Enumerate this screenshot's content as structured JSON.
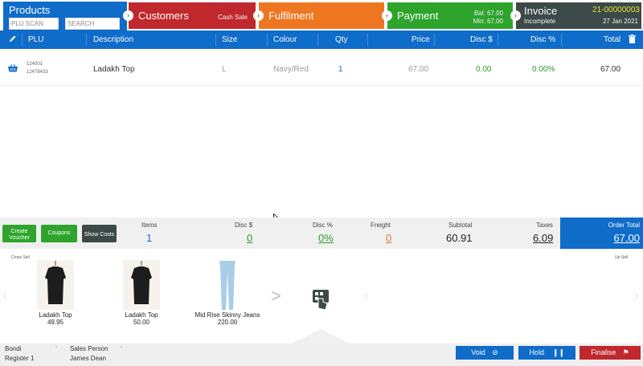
{
  "steps": {
    "products": {
      "title": "Products",
      "plu_placeholder": "PLU SCAN",
      "search_placeholder": "SEARCH"
    },
    "customers": {
      "label": "Customers",
      "sub": "Cash Sale"
    },
    "fulfilment": {
      "label": "Fulfilment"
    },
    "payment": {
      "label": "Payment",
      "balance": "Bal: 67.00",
      "minimum": "Min: 67.00"
    },
    "invoice": {
      "label": "Invoice",
      "number": "21-00000003",
      "status": "Incomplete",
      "date": "27 Jan 2021"
    }
  },
  "colors": {
    "primary": "#0f6cc9",
    "customers": "#c0282d",
    "fulfilment": "#ee7621",
    "payment": "#2ea42c",
    "invoice": "#3c4a47",
    "invoice_number": "#e7e23a",
    "discount_green": "#2e9b2e",
    "freight_orange": "#e07b39"
  },
  "table": {
    "headers": {
      "plu": "PLU",
      "description": "Description",
      "size": "Size",
      "colour": "Colour",
      "qty": "Qty",
      "price": "Price",
      "disc_amt": "Disc $",
      "disc_pct": "Disc %",
      "total": "Total"
    },
    "rows": [
      {
        "plu1": "124001",
        "plu2": "12478433",
        "description": "Ladakh Top",
        "size": "L",
        "colour": "Navy/Red",
        "qty": "1",
        "price": "67.00",
        "disc_amt": "0.00",
        "disc_pct": "0.00%",
        "total": "67.00"
      }
    ]
  },
  "totals": {
    "buttons": {
      "voucher": "Create Voucher",
      "coupons": "Coupons",
      "costs": "Show Costs"
    },
    "items_label": "Items",
    "items": "1",
    "disc_amt_label": "Disc $",
    "disc_amt": "0",
    "disc_pct_label": "Disc %",
    "disc_pct": "0%",
    "freight_label": "Freight",
    "freight": "0",
    "subtotal_label": "Subtotal",
    "subtotal": "60.91",
    "taxes_label": "Taxes",
    "taxes": "6.09",
    "order_total_label": "Order Total",
    "order_total": "67.00"
  },
  "cross_sell": {
    "left_label": "Cross Sell",
    "right_label": "Up Sell",
    "products": [
      {
        "name": "Ladakh Top",
        "price": "49.95"
      },
      {
        "name": "Ladakh Top",
        "price": "50.00"
      },
      {
        "name": "Mid Rise Skinny Jeans",
        "price": "220.00"
      }
    ],
    "next_arrow": ">"
  },
  "footer": {
    "store": "Bondi",
    "register": "Register 1",
    "salesperson_label": "Sales Person",
    "salesperson": "James Dean",
    "void": "Void",
    "hold": "Hold",
    "finalise": "Finalise"
  },
  "icons": {
    "edit": "pencil-icon",
    "delete": "trash-icon",
    "basket": "basket-icon",
    "void": "cancel-icon",
    "hold": "pause-icon",
    "finalise": "flag-icon"
  }
}
